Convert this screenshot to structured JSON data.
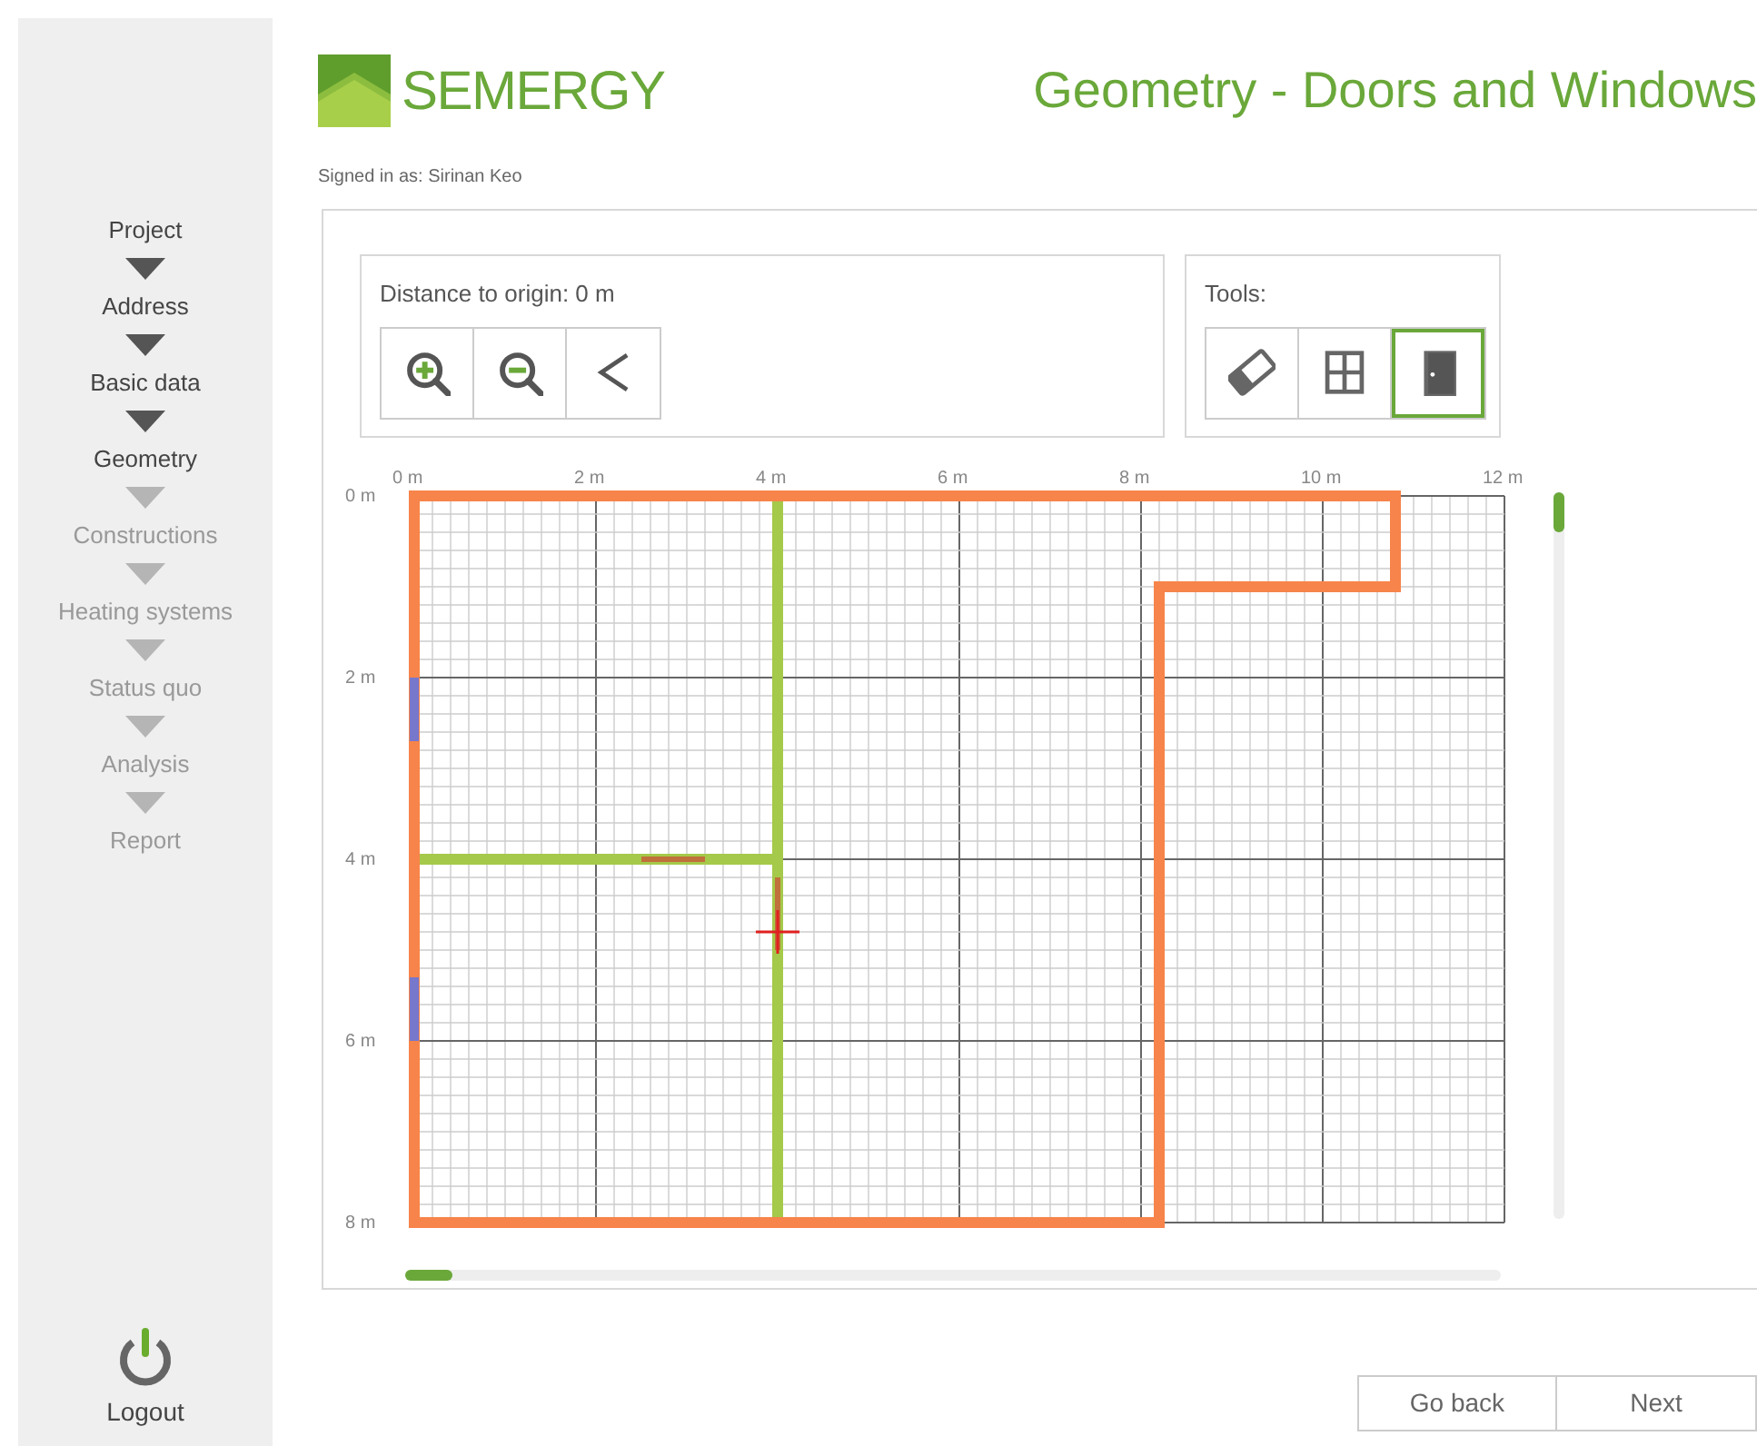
{
  "sidebar": {
    "steps": [
      {
        "label": "Project",
        "enabled": true
      },
      {
        "label": "Address",
        "enabled": true
      },
      {
        "label": "Basic data",
        "enabled": true
      },
      {
        "label": "Geometry",
        "enabled": true
      },
      {
        "label": "Constructions",
        "enabled": false
      },
      {
        "label": "Heating systems",
        "enabled": false
      },
      {
        "label": "Status quo",
        "enabled": false
      },
      {
        "label": "Analysis",
        "enabled": false
      },
      {
        "label": "Report",
        "enabled": false
      }
    ],
    "logout": "Logout"
  },
  "header": {
    "logo": "SEMERGY",
    "title": "Geometry - Doors and Windows",
    "signed_in": "Signed in as: Sirinan Keo"
  },
  "navigation": {
    "distance": "Distance to origin: 0 m",
    "buttons": [
      {
        "kind": "zoom-in"
      },
      {
        "kind": "zoom-out"
      },
      {
        "kind": "back"
      }
    ]
  },
  "tools": {
    "label": "Tools:",
    "items": [
      {
        "kind": "eraser",
        "selected": false
      },
      {
        "kind": "window",
        "selected": false
      },
      {
        "kind": "door",
        "selected": true
      }
    ]
  },
  "plan": {
    "x_ticks": [
      "0 m",
      "2 m",
      "4 m",
      "6 m",
      "8 m",
      "10 m",
      "12 m"
    ],
    "y_ticks": [
      "0 m",
      "2 m",
      "4 m",
      "6 m",
      "8 m"
    ]
  },
  "footer": {
    "buttons": [
      "Go back",
      "Next"
    ]
  }
}
